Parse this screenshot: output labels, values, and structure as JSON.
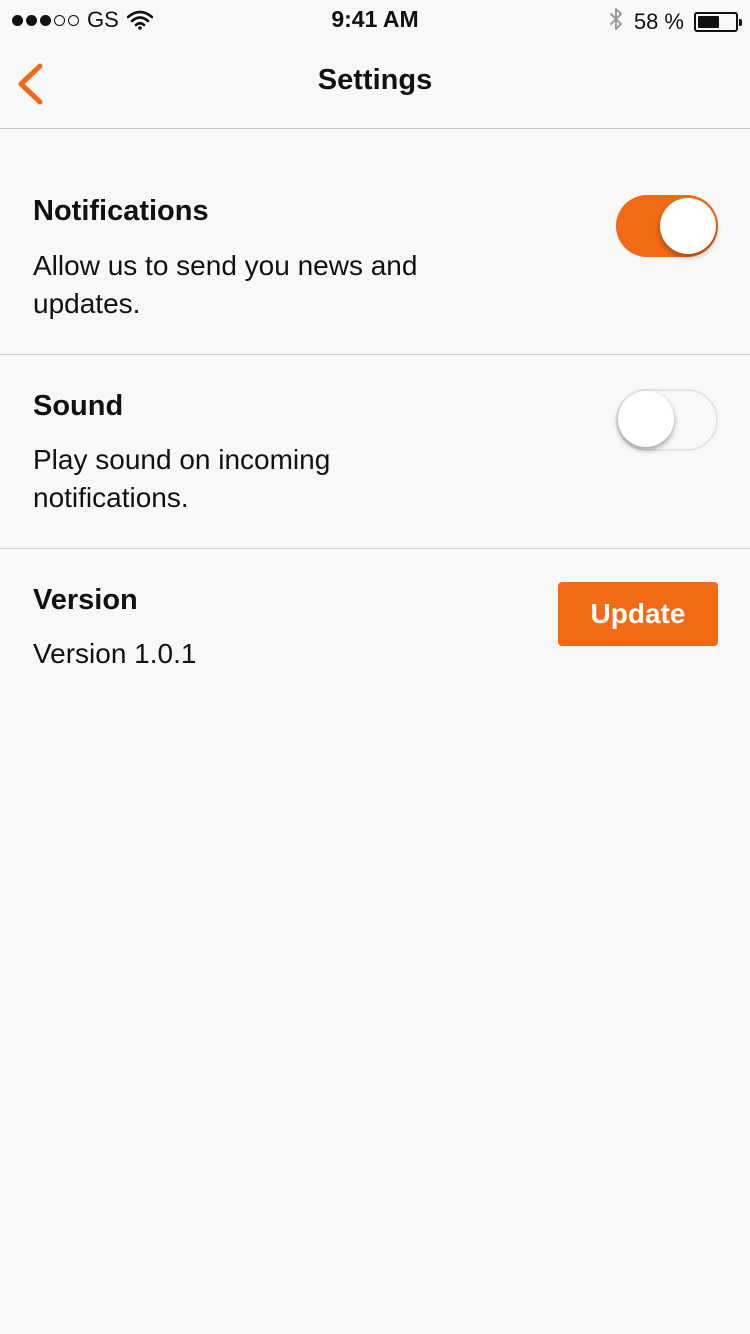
{
  "colors": {
    "accent": "#f26a16"
  },
  "status_bar": {
    "carrier": "GS",
    "signal_full": 3,
    "signal_empty": 2,
    "time": "9:41 AM",
    "battery_text": "58 %",
    "battery_level": 0.58,
    "icons": [
      "wifi-icon",
      "bluetooth-icon",
      "battery-icon"
    ]
  },
  "nav": {
    "title": "Settings",
    "back_icon": "chevron-left-icon"
  },
  "settings": {
    "notifications": {
      "title": "Notifications",
      "description": "Allow us to send you news and updates.",
      "enabled": true
    },
    "sound": {
      "title": "Sound",
      "description": "Play sound on incoming notifications.",
      "enabled": false
    },
    "version": {
      "title": "Version",
      "value": "Version 1.0.1",
      "button_label": "Update"
    }
  }
}
